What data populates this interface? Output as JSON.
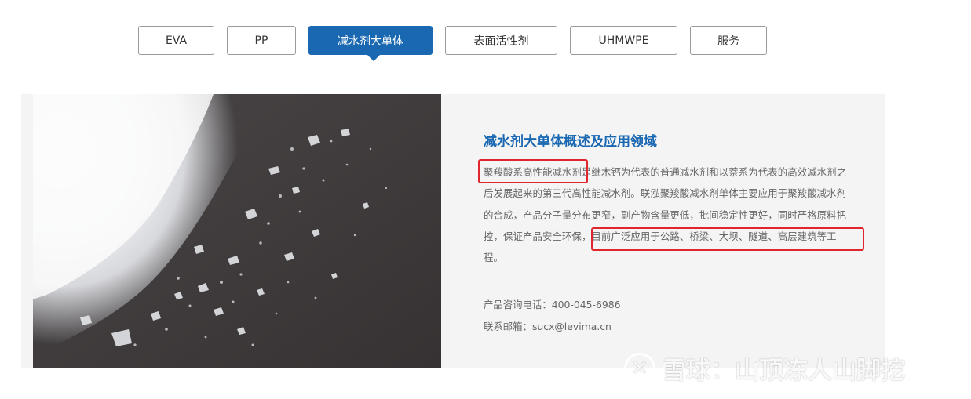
{
  "tabs": [
    {
      "label": "EVA"
    },
    {
      "label": "PP"
    },
    {
      "label": "减水剂大单体",
      "active": true
    },
    {
      "label": "表面活性剂"
    },
    {
      "label": "UHMWPE"
    },
    {
      "label": "服务"
    }
  ],
  "content": {
    "title": "减水剂大单体概述及应用领域",
    "body_lines": [
      "聚羧酸系高性能减水剂是继木钙为代表的普通减水剂和以萘系为代表的高效减水剂之",
      "后发展起来的第三代高性能减水剂。联泓聚羧酸减水剂单体主要应用于聚羧酸减水剂",
      "的合成，产品分子量分布更窄，副产物含量更低，批间稳定性更好，同时严格原料把",
      "控，保证产品安全环保，目前广泛应用于公路、桥梁、大坝、隧道、高层建筑等工",
      "程。"
    ],
    "phone": "产品咨询电话：400-045-6986",
    "email": "联系邮箱：sucx@levima.cn"
  },
  "watermark": {
    "text": "雪球：山顶冻人山脚挖",
    "logo_icon": "snowball-logo-icon"
  },
  "colors": {
    "accent": "#1a68b2",
    "highlight_box": "#e0262a",
    "panel_bg": "#f4f4f4"
  }
}
